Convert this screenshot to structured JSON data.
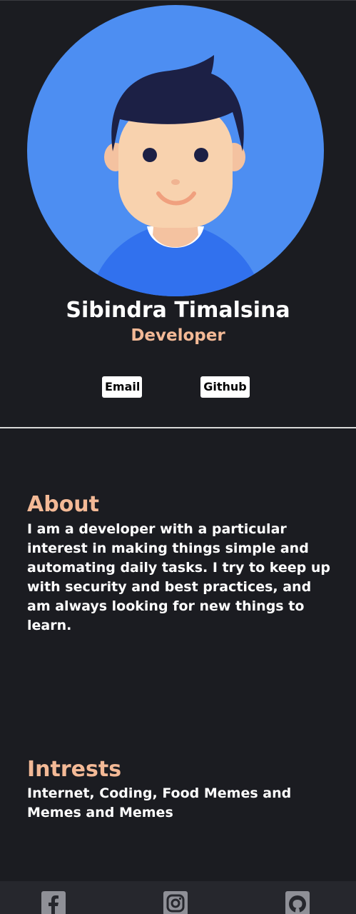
{
  "profile": {
    "name": "Sibindra Timalsina",
    "role": "Developer"
  },
  "links": {
    "email_label": "Email",
    "github_label": "Github"
  },
  "about": {
    "title": "About",
    "text": "I am a developer with a particular interest in making things simple and automating daily tasks. I try to keep up with security and best practices, and am always looking for new things to learn."
  },
  "interests": {
    "title": "Intrests",
    "text": "Internet, Coding, Food Memes and Memes and Memes"
  },
  "footer": {
    "icons": [
      "facebook-icon",
      "instagram-icon",
      "github-icon"
    ]
  },
  "colors": {
    "background": "#1b1c21",
    "accent": "#f3b996",
    "avatar_bg": "#4d8ef2"
  }
}
